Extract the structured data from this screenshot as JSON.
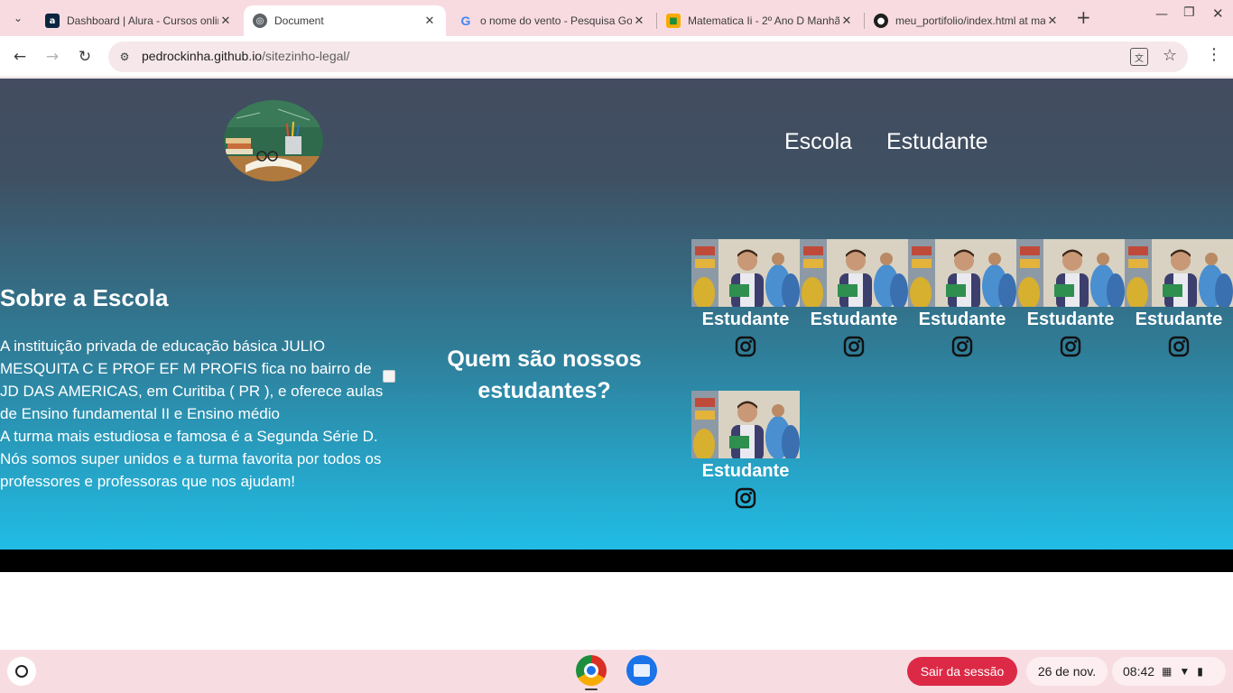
{
  "browser": {
    "tabs": [
      {
        "title": "Dashboard | Alura - Cursos online de tecnologia",
        "icon": "alura-icon",
        "active": false
      },
      {
        "title": "Document",
        "icon": "globe-icon",
        "active": true
      },
      {
        "title": "o nome do vento - Pesquisa Google",
        "icon": "google-icon",
        "active": false
      },
      {
        "title": "Matematica Ii - 2º Ano D Manhã",
        "icon": "classroom-icon",
        "active": false
      },
      {
        "title": "meu_portifolio/index.html at main",
        "icon": "github-icon",
        "active": false
      }
    ],
    "url_host": "pedrockinha.github.io",
    "url_path": "/sitezinho-legal/"
  },
  "site": {
    "nav": [
      "Escola",
      "Estudante"
    ],
    "about": {
      "title": "Sobre a Escola",
      "paragraph1": "A instituição privada de educação básica JULIO MESQUITA C E PROF EF M PROFIS fica no bairro de JD DAS AMERICAS, em Curitiba ( PR ), e oferece aulas de Ensino fundamental II e Ensino médio",
      "paragraph2": "A turma mais estudiosa e famosa é a Segunda Série D. Nós somos super unidos e a turma favorita por todos os professores e professoras que nos ajudam!"
    },
    "students_title": "Quem são nossos estudantes?",
    "students": [
      {
        "name": "Estudante"
      },
      {
        "name": "Estudante"
      },
      {
        "name": "Estudante"
      },
      {
        "name": "Estudante"
      },
      {
        "name": "Estudante"
      },
      {
        "name": "Estudante"
      }
    ]
  },
  "shelf": {
    "signout_label": "Sair da sessão",
    "date": "26 de nov.",
    "time": "08:42"
  },
  "colors": {
    "tabstrip": "#f8dbe1",
    "page_gradient_top": "#434c60",
    "page_gradient_bottom": "#1fc4ee",
    "signout": "#dc2a46"
  }
}
